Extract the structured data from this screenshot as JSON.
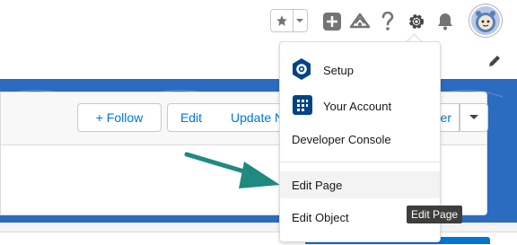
{
  "header": {
    "favorites_icon": "star-icon",
    "favorites_menu_icon": "chevron-down-icon",
    "global_actions_icon": "add-icon",
    "trailhead_icon": "trailhead-icon",
    "help_icon": "help-icon",
    "setup_icon": "gear-icon",
    "notifications_icon": "bell-icon",
    "avatar_icon": "astro-avatar-icon"
  },
  "record_header": {
    "buttons": {
      "follow": "+ Follow",
      "edit": "Edit",
      "update": "Update N",
      "hidden_partial": "er",
      "more_icon": "chevron-down-icon"
    }
  },
  "setup_menu": {
    "items": [
      {
        "label": "Setup",
        "icon": "gear-icon"
      },
      {
        "label": "Your Account",
        "icon": "account-icon"
      },
      {
        "label": "Developer Console",
        "icon": ""
      },
      {
        "label": "Edit Page",
        "icon": ""
      },
      {
        "label": "Edit Object",
        "icon": ""
      }
    ]
  },
  "tooltip": {
    "text": "Edit Page"
  },
  "annotation": {
    "arrow_color": "#1f8a7f"
  },
  "colors": {
    "brand_blue": "#0176d3",
    "banner_blue": "#2b6bc0",
    "setup_icon_bg": "#014486"
  }
}
